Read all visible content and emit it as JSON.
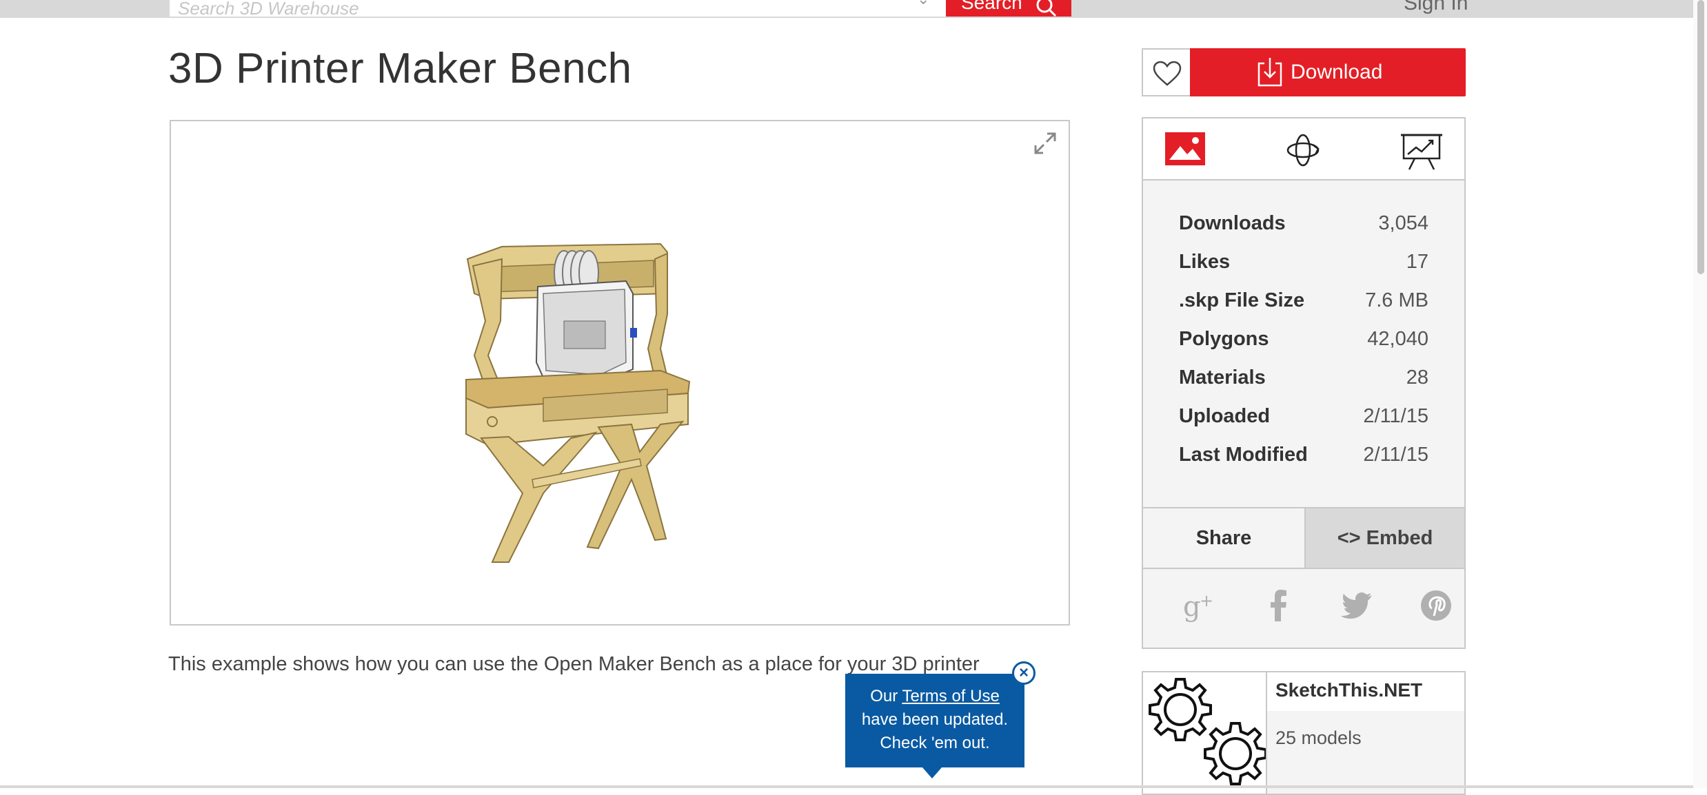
{
  "header": {
    "search_placeholder": "Search 3D Warehouse",
    "search_button": "Search",
    "sign_in": "Sign In"
  },
  "model": {
    "title": "3D Printer Maker Bench",
    "description": "This example shows how you can use the Open Maker Bench as a place for your 3D printer"
  },
  "actions": {
    "download_label": "Download"
  },
  "stats": [
    {
      "label": "Downloads",
      "value": "3,054"
    },
    {
      "label": "Likes",
      "value": "17"
    },
    {
      "label": ".skp File Size",
      "value": "7.6 MB"
    },
    {
      "label": "Polygons",
      "value": "42,040"
    },
    {
      "label": "Materials",
      "value": "28"
    },
    {
      "label": "Uploaded",
      "value": "2/11/15"
    },
    {
      "label": "Last Modified",
      "value": "2/11/15"
    }
  ],
  "share": {
    "share_tab": "Share",
    "embed_tab": "<> Embed"
  },
  "author": {
    "name": "SketchThis.NET",
    "models": "25 models"
  },
  "terms_popup": {
    "line1_prefix": "Our ",
    "link": "Terms of Use",
    "line2": "have been updated.",
    "line3": "Check 'em out."
  },
  "icons": {
    "tabs": [
      "image-icon",
      "3d-rotate-icon",
      "presentation-icon"
    ],
    "social": [
      "google-plus-icon",
      "facebook-icon",
      "twitter-icon",
      "pinterest-icon"
    ]
  },
  "colors": {
    "accent_red": "#e41e26",
    "popup_blue": "#0a5aa3"
  }
}
